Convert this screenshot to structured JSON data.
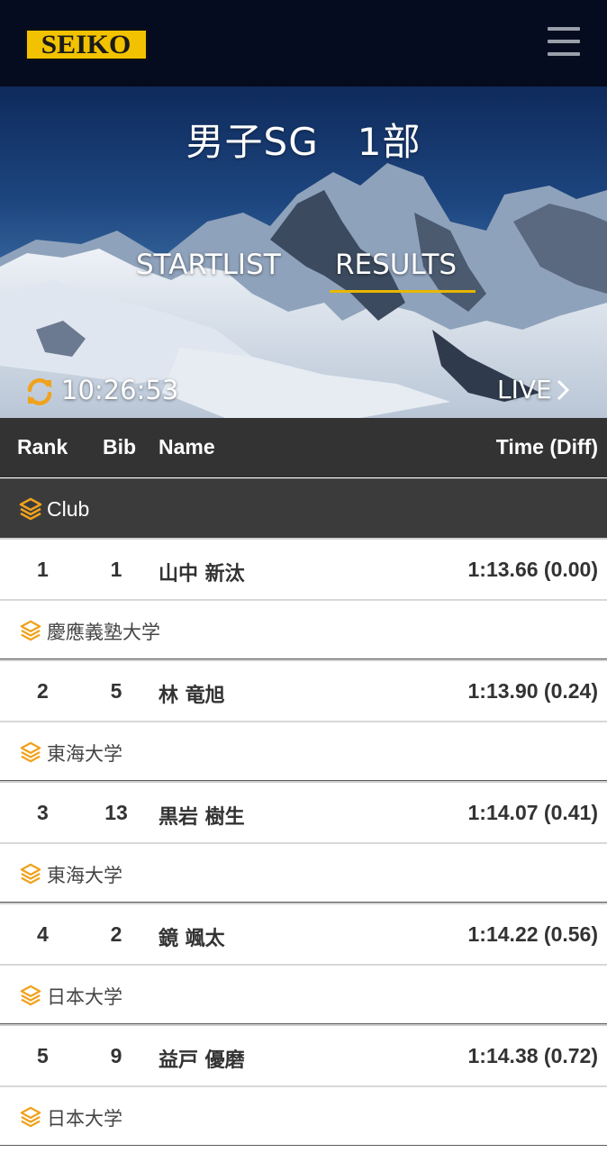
{
  "header": {
    "logo_text": "SEIKO",
    "brand_color": "#f2c200",
    "menu_icon": "hamburger-menu-icon"
  },
  "hero": {
    "title": "男子SG　1部",
    "tabs": [
      {
        "label": "STARTLIST",
        "active": false
      },
      {
        "label": "RESULTS",
        "active": true
      }
    ],
    "accent_color": "#e8b600",
    "refresh_icon": "refresh-icon",
    "time": "10:26:53",
    "live_label": "LIVE"
  },
  "table": {
    "columns": {
      "rank": "Rank",
      "bib": "Bib",
      "name": "Name",
      "time": "Time (Diff)"
    },
    "group_label": "Club",
    "group_icon": "layers-icon",
    "rows": [
      {
        "rank": "1",
        "bib": "1",
        "name": "山中 新汰",
        "time": "1:13.66 (0.00)",
        "club": "慶應義塾大学"
      },
      {
        "rank": "2",
        "bib": "5",
        "name": "林 竜旭",
        "time": "1:13.90 (0.24)",
        "club": "東海大学"
      },
      {
        "rank": "3",
        "bib": "13",
        "name": "黒岩 樹生",
        "time": "1:14.07 (0.41)",
        "club": "東海大学"
      },
      {
        "rank": "4",
        "bib": "2",
        "name": "鏡 颯太",
        "time": "1:14.22 (0.56)",
        "club": "日本大学"
      },
      {
        "rank": "5",
        "bib": "9",
        "name": "益戸 優磨",
        "time": "1:14.38 (0.72)",
        "club": "日本大学"
      }
    ]
  }
}
